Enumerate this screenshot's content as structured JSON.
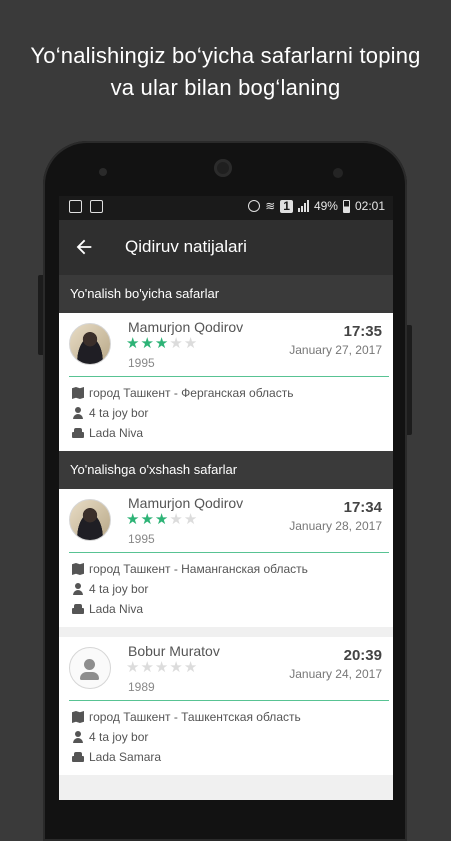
{
  "promo": {
    "line1": "Yo‘nalishingiz bo‘yicha safarlarni toping",
    "line2": "va ular bilan bog‘laning"
  },
  "status_bar": {
    "sim": "1",
    "battery": "49%",
    "time": "02:01"
  },
  "app_bar": {
    "back_icon": "arrow-left-icon",
    "title": "Qidiruv natijalari"
  },
  "sections": [
    {
      "title": "Yo'nalish bo'yicha safarlar",
      "trips": [
        {
          "driver": "Mamurjon Qodirov",
          "rating": 3,
          "max_rating": 5,
          "birth_year": "1995",
          "time": "17:35",
          "date": "January 27, 2017",
          "route": "город Ташкент - Ферганская область",
          "seats": "4 ta joy bor",
          "car": "Lada Niva",
          "has_photo": true
        }
      ]
    },
    {
      "title": "Yo'nalishga o'xshash safarlar",
      "trips": [
        {
          "driver": "Mamurjon Qodirov",
          "rating": 3,
          "max_rating": 5,
          "birth_year": "1995",
          "time": "17:34",
          "date": "January 28, 2017",
          "route": "город Ташкент - Наманганская область",
          "seats": "4 ta joy bor",
          "car": "Lada Niva",
          "has_photo": true
        },
        {
          "driver": "Bobur Muratov",
          "rating": 0,
          "max_rating": 5,
          "birth_year": "1989",
          "time": "20:39",
          "date": "January 24, 2017",
          "route": "город Ташкент - Ташкентская область",
          "seats": "4 ta joy bor",
          "car": "Lada Samara",
          "has_photo": false
        }
      ]
    }
  ],
  "colors": {
    "accent": "#2db376",
    "star_off": "#dcdcdc",
    "app_bar": "#2f2f2f",
    "section_header": "#3a3a3a"
  }
}
